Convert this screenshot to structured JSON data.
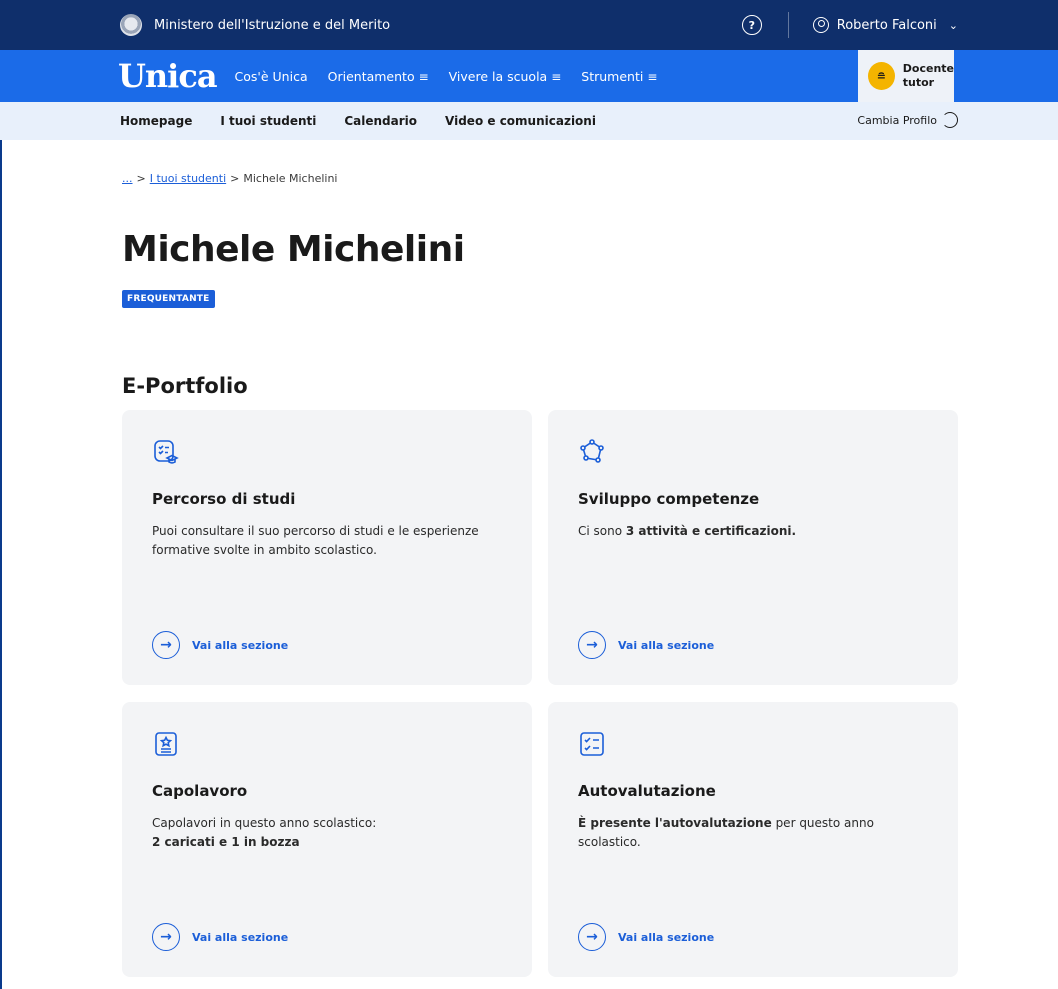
{
  "topbar": {
    "ministry": "Ministero dell'Istruzione e del Merito",
    "help_icon": "?",
    "user_name": "Roberto Falconi",
    "chevron": "⌄"
  },
  "mainnav": {
    "logo": "Unica",
    "items": [
      {
        "label": "Cos'è Unica",
        "has_menu": false
      },
      {
        "label": "Orientamento",
        "has_menu": true
      },
      {
        "label": "Vivere la scuola",
        "has_menu": true
      },
      {
        "label": "Strumenti",
        "has_menu": true
      }
    ],
    "menu_glyph": "≡",
    "profile": {
      "line1": "Docente",
      "line2": "tutor",
      "badge_glyph": "≘"
    }
  },
  "subnav": {
    "items": [
      "Homepage",
      "I tuoi studenti",
      "Calendario",
      "Video e comunicazioni"
    ],
    "change_profile": "Cambia Profilo"
  },
  "breadcrumb": {
    "root": "...",
    "sep": ">",
    "link": "I tuoi studenti",
    "current": "Michele Michelini"
  },
  "student": {
    "name": "Michele Michelini",
    "status": "FREQUENTANTE"
  },
  "portfolio": {
    "title": "E-Portfolio",
    "cards": [
      {
        "icon": "study-path-icon",
        "title": "Percorso di studi",
        "desc_pre": "Puoi consultare il suo percorso di studi e le esperienze formative svolte in ambito scolastico.",
        "desc_bold": "",
        "desc_post": "",
        "link": "Vai alla sezione"
      },
      {
        "icon": "skills-network-icon",
        "title": "Sviluppo competenze",
        "desc_pre": "Ci sono ",
        "desc_bold": "3 attività e certificazioni.",
        "desc_post": "",
        "link": "Vai alla sezione"
      },
      {
        "icon": "masterpiece-icon",
        "title": "Capolavoro",
        "desc_pre": "Capolavori in questo anno scolastico:",
        "desc_bold": "2 caricati e 1 in bozza",
        "desc_post": "",
        "link": "Vai alla sezione"
      },
      {
        "icon": "checklist-icon",
        "title": "Autovalutazione",
        "desc_pre": "",
        "desc_bold": "È presente l'autovalutazione",
        "desc_post": " per questo anno scolastico.",
        "link": "Vai alla sezione"
      }
    ]
  },
  "colors": {
    "topbar": "#0f2f6b",
    "nav": "#1b6be8",
    "subnav": "#e8f0fb",
    "accent": "#1b5ed8",
    "card_bg": "#f3f4f6",
    "profile_badge": "#f4b400"
  }
}
